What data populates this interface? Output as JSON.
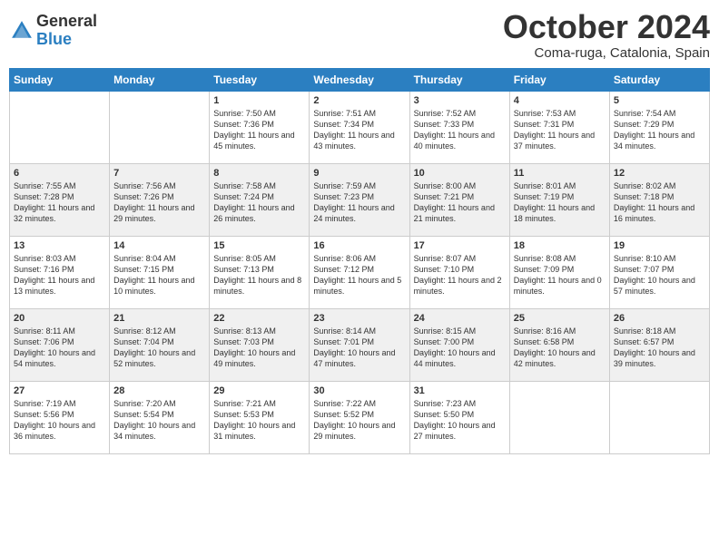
{
  "header": {
    "logo": {
      "general": "General",
      "blue": "Blue"
    },
    "title": "October 2024",
    "location": "Coma-ruga, Catalonia, Spain"
  },
  "days_of_week": [
    "Sunday",
    "Monday",
    "Tuesday",
    "Wednesday",
    "Thursday",
    "Friday",
    "Saturday"
  ],
  "weeks": [
    [
      {
        "day": "",
        "sunrise": "",
        "sunset": "",
        "daylight": ""
      },
      {
        "day": "",
        "sunrise": "",
        "sunset": "",
        "daylight": ""
      },
      {
        "day": "1",
        "sunrise": "Sunrise: 7:50 AM",
        "sunset": "Sunset: 7:36 PM",
        "daylight": "Daylight: 11 hours and 45 minutes."
      },
      {
        "day": "2",
        "sunrise": "Sunrise: 7:51 AM",
        "sunset": "Sunset: 7:34 PM",
        "daylight": "Daylight: 11 hours and 43 minutes."
      },
      {
        "day": "3",
        "sunrise": "Sunrise: 7:52 AM",
        "sunset": "Sunset: 7:33 PM",
        "daylight": "Daylight: 11 hours and 40 minutes."
      },
      {
        "day": "4",
        "sunrise": "Sunrise: 7:53 AM",
        "sunset": "Sunset: 7:31 PM",
        "daylight": "Daylight: 11 hours and 37 minutes."
      },
      {
        "day": "5",
        "sunrise": "Sunrise: 7:54 AM",
        "sunset": "Sunset: 7:29 PM",
        "daylight": "Daylight: 11 hours and 34 minutes."
      }
    ],
    [
      {
        "day": "6",
        "sunrise": "Sunrise: 7:55 AM",
        "sunset": "Sunset: 7:28 PM",
        "daylight": "Daylight: 11 hours and 32 minutes."
      },
      {
        "day": "7",
        "sunrise": "Sunrise: 7:56 AM",
        "sunset": "Sunset: 7:26 PM",
        "daylight": "Daylight: 11 hours and 29 minutes."
      },
      {
        "day": "8",
        "sunrise": "Sunrise: 7:58 AM",
        "sunset": "Sunset: 7:24 PM",
        "daylight": "Daylight: 11 hours and 26 minutes."
      },
      {
        "day": "9",
        "sunrise": "Sunrise: 7:59 AM",
        "sunset": "Sunset: 7:23 PM",
        "daylight": "Daylight: 11 hours and 24 minutes."
      },
      {
        "day": "10",
        "sunrise": "Sunrise: 8:00 AM",
        "sunset": "Sunset: 7:21 PM",
        "daylight": "Daylight: 11 hours and 21 minutes."
      },
      {
        "day": "11",
        "sunrise": "Sunrise: 8:01 AM",
        "sunset": "Sunset: 7:19 PM",
        "daylight": "Daylight: 11 hours and 18 minutes."
      },
      {
        "day": "12",
        "sunrise": "Sunrise: 8:02 AM",
        "sunset": "Sunset: 7:18 PM",
        "daylight": "Daylight: 11 hours and 16 minutes."
      }
    ],
    [
      {
        "day": "13",
        "sunrise": "Sunrise: 8:03 AM",
        "sunset": "Sunset: 7:16 PM",
        "daylight": "Daylight: 11 hours and 13 minutes."
      },
      {
        "day": "14",
        "sunrise": "Sunrise: 8:04 AM",
        "sunset": "Sunset: 7:15 PM",
        "daylight": "Daylight: 11 hours and 10 minutes."
      },
      {
        "day": "15",
        "sunrise": "Sunrise: 8:05 AM",
        "sunset": "Sunset: 7:13 PM",
        "daylight": "Daylight: 11 hours and 8 minutes."
      },
      {
        "day": "16",
        "sunrise": "Sunrise: 8:06 AM",
        "sunset": "Sunset: 7:12 PM",
        "daylight": "Daylight: 11 hours and 5 minutes."
      },
      {
        "day": "17",
        "sunrise": "Sunrise: 8:07 AM",
        "sunset": "Sunset: 7:10 PM",
        "daylight": "Daylight: 11 hours and 2 minutes."
      },
      {
        "day": "18",
        "sunrise": "Sunrise: 8:08 AM",
        "sunset": "Sunset: 7:09 PM",
        "daylight": "Daylight: 11 hours and 0 minutes."
      },
      {
        "day": "19",
        "sunrise": "Sunrise: 8:10 AM",
        "sunset": "Sunset: 7:07 PM",
        "daylight": "Daylight: 10 hours and 57 minutes."
      }
    ],
    [
      {
        "day": "20",
        "sunrise": "Sunrise: 8:11 AM",
        "sunset": "Sunset: 7:06 PM",
        "daylight": "Daylight: 10 hours and 54 minutes."
      },
      {
        "day": "21",
        "sunrise": "Sunrise: 8:12 AM",
        "sunset": "Sunset: 7:04 PM",
        "daylight": "Daylight: 10 hours and 52 minutes."
      },
      {
        "day": "22",
        "sunrise": "Sunrise: 8:13 AM",
        "sunset": "Sunset: 7:03 PM",
        "daylight": "Daylight: 10 hours and 49 minutes."
      },
      {
        "day": "23",
        "sunrise": "Sunrise: 8:14 AM",
        "sunset": "Sunset: 7:01 PM",
        "daylight": "Daylight: 10 hours and 47 minutes."
      },
      {
        "day": "24",
        "sunrise": "Sunrise: 8:15 AM",
        "sunset": "Sunset: 7:00 PM",
        "daylight": "Daylight: 10 hours and 44 minutes."
      },
      {
        "day": "25",
        "sunrise": "Sunrise: 8:16 AM",
        "sunset": "Sunset: 6:58 PM",
        "daylight": "Daylight: 10 hours and 42 minutes."
      },
      {
        "day": "26",
        "sunrise": "Sunrise: 8:18 AM",
        "sunset": "Sunset: 6:57 PM",
        "daylight": "Daylight: 10 hours and 39 minutes."
      }
    ],
    [
      {
        "day": "27",
        "sunrise": "Sunrise: 7:19 AM",
        "sunset": "Sunset: 5:56 PM",
        "daylight": "Daylight: 10 hours and 36 minutes."
      },
      {
        "day": "28",
        "sunrise": "Sunrise: 7:20 AM",
        "sunset": "Sunset: 5:54 PM",
        "daylight": "Daylight: 10 hours and 34 minutes."
      },
      {
        "day": "29",
        "sunrise": "Sunrise: 7:21 AM",
        "sunset": "Sunset: 5:53 PM",
        "daylight": "Daylight: 10 hours and 31 minutes."
      },
      {
        "day": "30",
        "sunrise": "Sunrise: 7:22 AM",
        "sunset": "Sunset: 5:52 PM",
        "daylight": "Daylight: 10 hours and 29 minutes."
      },
      {
        "day": "31",
        "sunrise": "Sunrise: 7:23 AM",
        "sunset": "Sunset: 5:50 PM",
        "daylight": "Daylight: 10 hours and 27 minutes."
      },
      {
        "day": "",
        "sunrise": "",
        "sunset": "",
        "daylight": ""
      },
      {
        "day": "",
        "sunrise": "",
        "sunset": "",
        "daylight": ""
      }
    ]
  ]
}
